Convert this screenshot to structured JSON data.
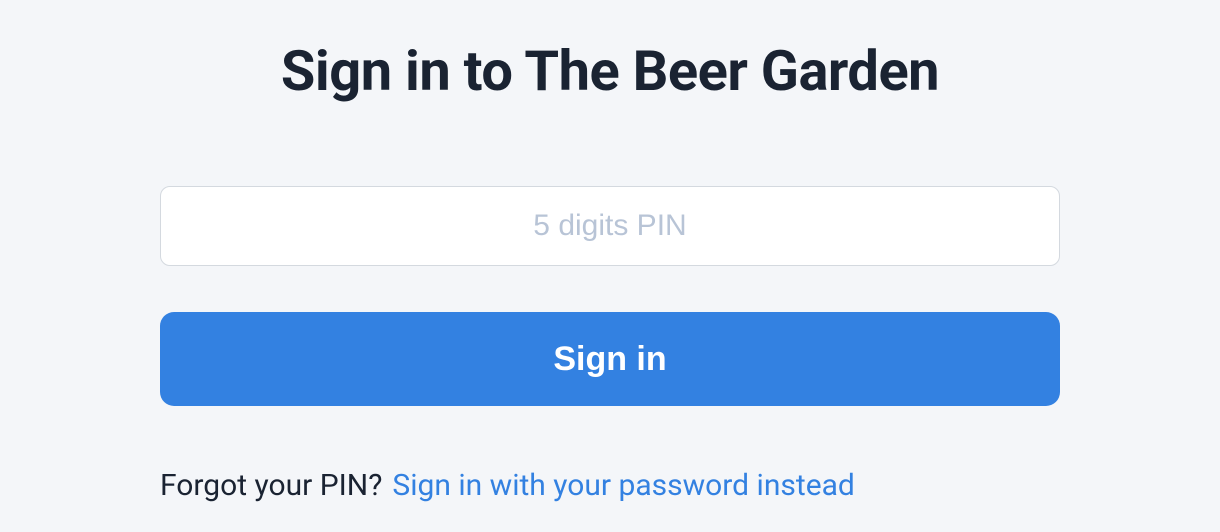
{
  "heading": "Sign in to The Beer Garden",
  "form": {
    "pin_placeholder": "5 digits PIN",
    "pin_value": "",
    "submit_label": "Sign in"
  },
  "helper": {
    "prompt": "Forgot your PIN?",
    "link_label": "Sign in with your password instead"
  },
  "colors": {
    "background": "#f4f6f9",
    "heading_text": "#1a2332",
    "input_border": "#d4d9df",
    "placeholder": "#b8c4d6",
    "button_bg": "#3381e1",
    "button_text": "#ffffff",
    "link": "#3381e1"
  }
}
